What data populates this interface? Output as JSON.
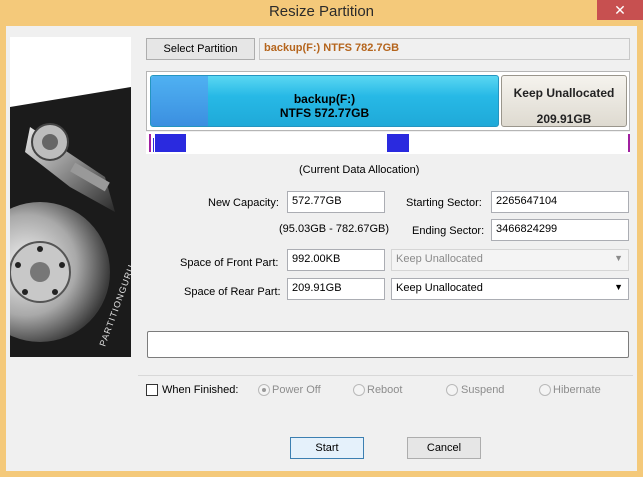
{
  "window": {
    "title": "Resize Partition"
  },
  "select_partition_button": "Select Partition",
  "partition_name": "backup(F:) NTFS 782.7GB",
  "bar": {
    "used_name": "backup(F:)",
    "used_desc": "NTFS 572.77GB",
    "free_name": "Keep Unallocated",
    "free_size": "209.91GB"
  },
  "alloc_caption": "(Current Data Allocation)",
  "fields": {
    "new_capacity_label": "New Capacity:",
    "new_capacity_value": "572.77GB",
    "range_text": "(95.03GB - 782.67GB)",
    "starting_sector_label": "Starting Sector:",
    "starting_sector_value": "2265647104",
    "ending_sector_label": "Ending Sector:",
    "ending_sector_value": "3466824299",
    "front_label": "Space of Front Part:",
    "front_value": "992.00KB",
    "front_option": "Keep Unallocated",
    "rear_label": "Space of Rear Part:",
    "rear_value": "209.91GB",
    "rear_option": "Keep Unallocated"
  },
  "finish": {
    "label": "When Finished:",
    "options": [
      "Power Off",
      "Reboot",
      "Suspend",
      "Hibernate"
    ],
    "selected": "Power Off"
  },
  "buttons": {
    "start": "Start",
    "cancel": "Cancel"
  },
  "colors": {
    "title_bar": "#f4c97a",
    "used_segment": "#27b9e6",
    "free_segment": "#dedad0",
    "partition_name": "#b5651d"
  }
}
